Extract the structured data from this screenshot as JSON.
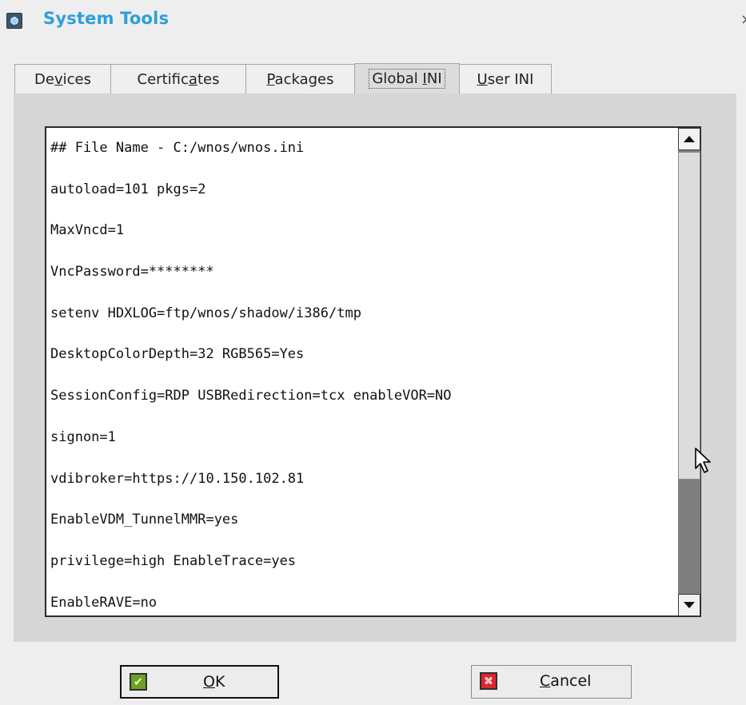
{
  "window": {
    "title": "System Tools",
    "close_glyph": "×"
  },
  "tabs": [
    {
      "label": "Devices",
      "underline_index": 2,
      "active": false
    },
    {
      "label": "Certificates",
      "underline_index": 8,
      "active": false
    },
    {
      "label": "Packages",
      "underline_index": 0,
      "active": false
    },
    {
      "label": "Global INI",
      "underline_index": 7,
      "active": true
    },
    {
      "label": "User INI",
      "underline_index": 0,
      "active": false
    }
  ],
  "editor": {
    "lines": [
      "## File Name - C:/wnos/wnos.ini",
      "autoload=101 pkgs=2",
      "MaxVncd=1",
      "VncPassword=********",
      "setenv HDXLOG=ftp/wnos/shadow/i386/tmp",
      "DesktopColorDepth=32 RGB565=Yes",
      "SessionConfig=RDP USBRedirection=tcx enableVOR=NO",
      "signon=1",
      "vdibroker=https://10.150.102.81",
      "EnableVDM_TunnelMMR=yes",
      "privilege=high EnableTrace=yes",
      "EnableRAVE=no"
    ]
  },
  "buttons": {
    "ok": {
      "label": "OK",
      "underline_index": 0,
      "icon": "checkmark-icon"
    },
    "cancel": {
      "label": "Cancel",
      "underline_index": 0,
      "icon": "x-icon"
    }
  },
  "colors": {
    "title": "#2c9fd9",
    "ok_icon": "#6c9f27",
    "cancel_icon": "#d9272d"
  }
}
